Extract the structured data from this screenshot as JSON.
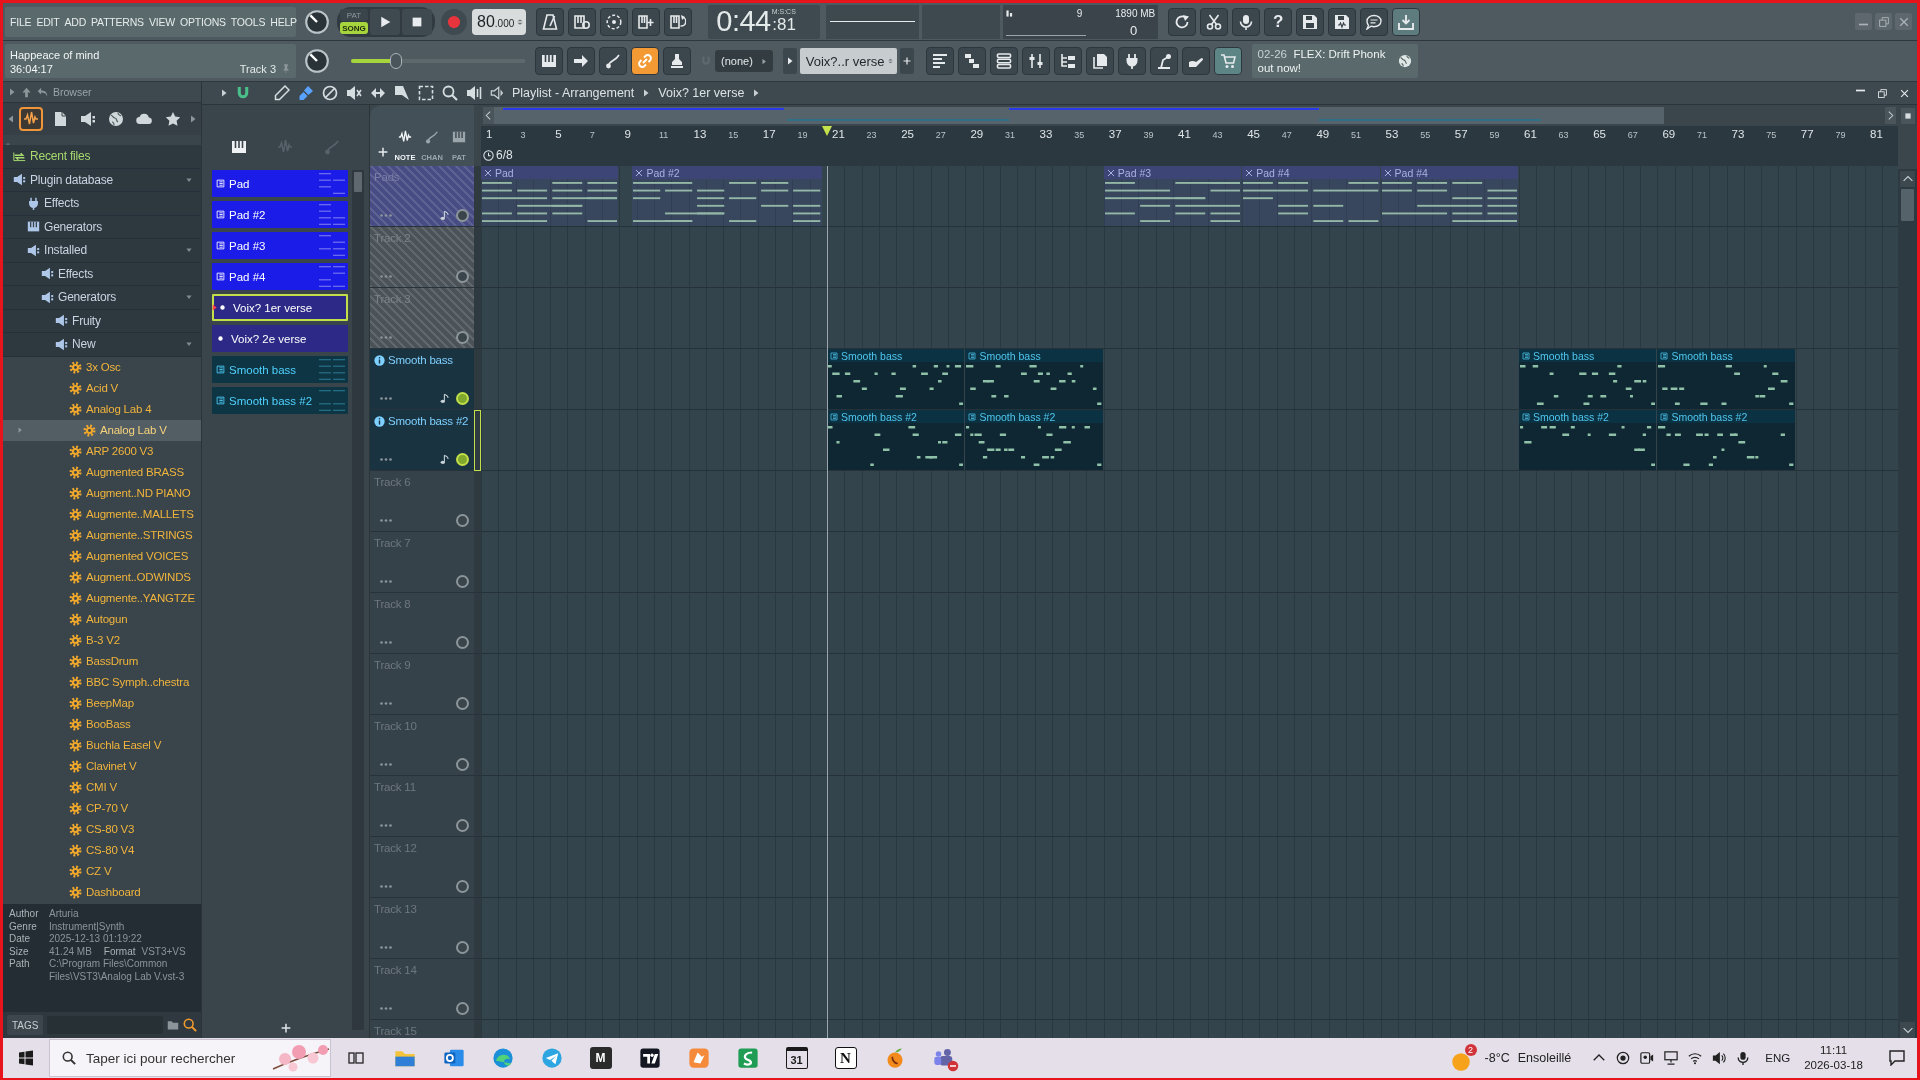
{
  "menu": [
    "FILE",
    "EDIT",
    "ADD",
    "PATTERNS",
    "VIEW",
    "OPTIONS",
    "TOOLS",
    "HELP"
  ],
  "transport": {
    "modes": [
      {
        "label": "PAT",
        "selected": false
      },
      {
        "label": "SONG",
        "selected": true
      }
    ],
    "tempo_whole": "80",
    "tempo_fraction": ".000"
  },
  "clock": {
    "main": "0:44",
    "centiseconds": ":81",
    "format": "M:S:CS"
  },
  "monitor": {
    "polyphony": "9",
    "memory": "1890 MB",
    "voices": "0"
  },
  "help_button": {
    "label": "?"
  },
  "song": {
    "title": "Happeace of mind",
    "time": "36:04:17",
    "hint": "Track 3"
  },
  "main_slider": {
    "level": 0.26
  },
  "link_toggle": {
    "on": true
  },
  "snap": {
    "value": "(none)"
  },
  "pattern_selector": {
    "value": "Voix?..r verse"
  },
  "news": {
    "date": "02-26",
    "text": "FLEX: Drift Phonk out now!"
  },
  "browser": {
    "title": "Browser",
    "tabs": [
      {
        "selected": true
      },
      {
        "selected": false
      },
      {
        "selected": false
      },
      {
        "selected": false
      },
      {
        "selected": false
      },
      {
        "selected": false
      }
    ],
    "tree": [
      {
        "label": "Recent files",
        "kind": "recent",
        "selected": false
      },
      {
        "label": "Plugin database",
        "kind": "folder",
        "expanded": true,
        "selected": false,
        "children": [
          {
            "label": "Effects",
            "kind": "effects",
            "selected": false
          },
          {
            "label": "Generators",
            "kind": "generators",
            "selected": false
          },
          {
            "label": "Installed",
            "kind": "folder",
            "expanded": true,
            "selected": false,
            "children": [
              {
                "label": "Effects",
                "kind": "folder",
                "expanded": false,
                "selected": false
              },
              {
                "label": "Generators",
                "kind": "folder",
                "expanded": true,
                "selected": false,
                "children": [
                  {
                    "label": "Fruity",
                    "kind": "folder",
                    "expanded": false,
                    "selected": false
                  },
                  {
                    "label": "New",
                    "kind": "folder",
                    "expanded": true,
                    "selected": false,
                    "children": [
                      {
                        "label": "3x Osc",
                        "kind": "plugin",
                        "selected": false
                      },
                      {
                        "label": "Acid V",
                        "kind": "plugin",
                        "selected": false
                      },
                      {
                        "label": "Analog Lab 4",
                        "kind": "plugin",
                        "selected": false
                      },
                      {
                        "label": "Analog Lab V",
                        "kind": "plugin",
                        "selected": true
                      },
                      {
                        "label": "ARP 2600 V3",
                        "kind": "plugin",
                        "selected": false
                      },
                      {
                        "label": "Augmented BRASS",
                        "kind": "plugin",
                        "selected": false
                      },
                      {
                        "label": "Augment..ND PIANO",
                        "kind": "plugin",
                        "selected": false
                      },
                      {
                        "label": "Augmente..MALLETS",
                        "kind": "plugin",
                        "selected": false
                      },
                      {
                        "label": "Augmente..STRINGS",
                        "kind": "plugin",
                        "selected": false
                      },
                      {
                        "label": "Augmented VOICES",
                        "kind": "plugin",
                        "selected": false
                      },
                      {
                        "label": "Augment..ODWINDS",
                        "kind": "plugin",
                        "selected": false
                      },
                      {
                        "label": "Augmente..YANGTZE",
                        "kind": "plugin",
                        "selected": false
                      },
                      {
                        "label": "Autogun",
                        "kind": "plugin",
                        "selected": false
                      },
                      {
                        "label": "B-3 V2",
                        "kind": "plugin",
                        "selected": false
                      },
                      {
                        "label": "BassDrum",
                        "kind": "plugin",
                        "selected": false
                      },
                      {
                        "label": "BBC Symph..chestra",
                        "kind": "plugin",
                        "selected": false
                      },
                      {
                        "label": "BeepMap",
                        "kind": "plugin",
                        "selected": false
                      },
                      {
                        "label": "BooBass",
                        "kind": "plugin",
                        "selected": false
                      },
                      {
                        "label": "Buchla Easel V",
                        "kind": "plugin",
                        "selected": false
                      },
                      {
                        "label": "Clavinet V",
                        "kind": "plugin",
                        "selected": false
                      },
                      {
                        "label": "CMI V",
                        "kind": "plugin",
                        "selected": false
                      },
                      {
                        "label": "CP-70 V",
                        "kind": "plugin",
                        "selected": false
                      },
                      {
                        "label": "CS-80 V3",
                        "kind": "plugin",
                        "selected": false
                      },
                      {
                        "label": "CS-80 V4",
                        "kind": "plugin",
                        "selected": false
                      },
                      {
                        "label": "CZ V",
                        "kind": "plugin",
                        "selected": false
                      },
                      {
                        "label": "Dashboard",
                        "kind": "plugin",
                        "selected": false
                      }
                    ]
                  }
                ]
              }
            ]
          }
        ]
      }
    ],
    "info": [
      {
        "label": "Author",
        "value": "Arturia"
      },
      {
        "label": "Genre",
        "value": "Instrument|Synth"
      },
      {
        "label": "Date",
        "value": "2025-12-13 01:19:22"
      },
      {
        "label": "Size",
        "value": "41.24 MB",
        "extra_label": "Format",
        "extra_value": "VST3+VS"
      },
      {
        "label": "Path",
        "value": "C:\\Program Files\\Common Files\\VST3\\Analog Lab V.vst-3"
      }
    ],
    "tags_label": "TAGS"
  },
  "playlist": {
    "title": "Playlist - Arrangement",
    "crumb": "Voix? 1er verse",
    "tools": [
      {
        "selected": false
      },
      {
        "selected": true
      },
      {
        "selected": false
      },
      {
        "selected": false
      },
      {
        "selected": false
      },
      {
        "selected": false
      },
      {
        "selected": false
      },
      {
        "selected": false
      },
      {
        "selected": false
      }
    ],
    "picker_tabs": [
      {
        "selected": true
      },
      {
        "selected": false
      },
      {
        "selected": false
      }
    ],
    "filters": [
      {
        "label": "NOTE",
        "selected": true
      },
      {
        "label": "CHAN",
        "selected": false
      },
      {
        "label": "PAT",
        "selected": false
      }
    ],
    "patterns": [
      {
        "label": "Pad",
        "kind": "pattern",
        "selected": false,
        "color": "#1c1ce8"
      },
      {
        "label": "Pad #2",
        "kind": "pattern",
        "selected": false,
        "color": "#1c1ce8"
      },
      {
        "label": "Pad #3",
        "kind": "pattern",
        "selected": false,
        "color": "#1c1ce8"
      },
      {
        "label": "Pad #4",
        "kind": "pattern",
        "selected": false,
        "color": "#1c1ce8"
      },
      {
        "label": "Voix? 1er verse",
        "kind": "audio",
        "selected": true,
        "color": "#2c2a86"
      },
      {
        "label": "Voix? 2e verse",
        "kind": "audio",
        "selected": false,
        "color": "#2c2a86"
      },
      {
        "label": "Smooth bass",
        "kind": "pattern",
        "selected": false,
        "color": "#0d3543"
      },
      {
        "label": "Smooth bass #2",
        "kind": "pattern",
        "selected": false,
        "color": "#0d3543"
      }
    ],
    "time_signature": "6/8",
    "ruler": [
      "1",
      "3",
      "5",
      "7",
      "9",
      "11",
      "13",
      "15",
      "17",
      "19",
      "21",
      "23",
      "25",
      "27",
      "29",
      "31",
      "33",
      "35",
      "37",
      "39",
      "41",
      "43",
      "45",
      "47",
      "49",
      "51",
      "53",
      "55",
      "57",
      "59",
      "61",
      "63",
      "65",
      "67",
      "69",
      "71",
      "73",
      "75",
      "77",
      "79",
      "81"
    ],
    "playhead": {
      "level": 0.25
    },
    "tracks": [
      {
        "label": "Pads",
        "kind": "pattern",
        "color": "#474c84",
        "hatched": true,
        "lit": false,
        "selected": false,
        "clips": [
          {
            "label": "Pad"
          },
          {
            "label": "Pad #2"
          },
          {
            "label": "Pad #3"
          },
          {
            "label": "Pad #4"
          },
          {
            "label": "Pad #4"
          }
        ]
      },
      {
        "label": "Track 2",
        "kind": "empty",
        "color": "#4b5359",
        "hatched": true,
        "lit": false,
        "selected": false
      },
      {
        "label": "Track 3",
        "kind": "empty",
        "color": "#4b5359",
        "hatched": true,
        "lit": false,
        "selected": false
      },
      {
        "label": "Smooth bass",
        "kind": "instrument",
        "color": "#1a3341",
        "hatched": false,
        "lit": true,
        "selected": false,
        "clips": [
          {
            "label": "Smooth bass"
          },
          {
            "label": "Smooth bass"
          },
          {
            "label": "Smooth bass"
          },
          {
            "label": "Smooth bass"
          }
        ]
      },
      {
        "label": "Smooth bass #2",
        "kind": "instrument",
        "color": "#1a3341",
        "hatched": false,
        "lit": true,
        "selected": true,
        "clips": [
          {
            "label": "Smooth bass #2"
          },
          {
            "label": "Smooth bass #2"
          },
          {
            "label": "Smooth bass #2"
          },
          {
            "label": "Smooth bass #2"
          }
        ]
      },
      {
        "label": "Track 6",
        "kind": "empty",
        "color": "#35424a",
        "hatched": false,
        "lit": false,
        "selected": false
      },
      {
        "label": "Track 7",
        "kind": "empty",
        "color": "#35424a",
        "hatched": false,
        "lit": false,
        "selected": false
      },
      {
        "label": "Track 8",
        "kind": "empty",
        "color": "#35424a",
        "hatched": false,
        "lit": false,
        "selected": false
      },
      {
        "label": "Track 9",
        "kind": "empty",
        "color": "#35424a",
        "hatched": false,
        "lit": false,
        "selected": false
      },
      {
        "label": "Track 10",
        "kind": "empty",
        "color": "#35424a",
        "hatched": false,
        "lit": false,
        "selected": false
      },
      {
        "label": "Track 11",
        "kind": "empty",
        "color": "#35424a",
        "hatched": false,
        "lit": false,
        "selected": false
      },
      {
        "label": "Track 12",
        "kind": "empty",
        "color": "#35424a",
        "hatched": false,
        "lit": false,
        "selected": false
      },
      {
        "label": "Track 13",
        "kind": "empty",
        "color": "#35424a",
        "hatched": false,
        "lit": false,
        "selected": false
      },
      {
        "label": "Track 14",
        "kind": "empty",
        "color": "#35424a",
        "hatched": false,
        "lit": false,
        "selected": false
      },
      {
        "label": "Track 15",
        "kind": "empty",
        "color": "#35424a",
        "hatched": false,
        "selected": false
      }
    ]
  },
  "taskbar": {
    "search": {
      "placeholder": "Taper ici pour rechercher"
    },
    "app_letters": [
      "M",
      "31",
      "N"
    ],
    "weather": {
      "badge": "2",
      "temperature": "-8°C",
      "condition": "Ensoleillé"
    },
    "language": "ENG",
    "time": "11:11",
    "date": "2026-03-18"
  }
}
